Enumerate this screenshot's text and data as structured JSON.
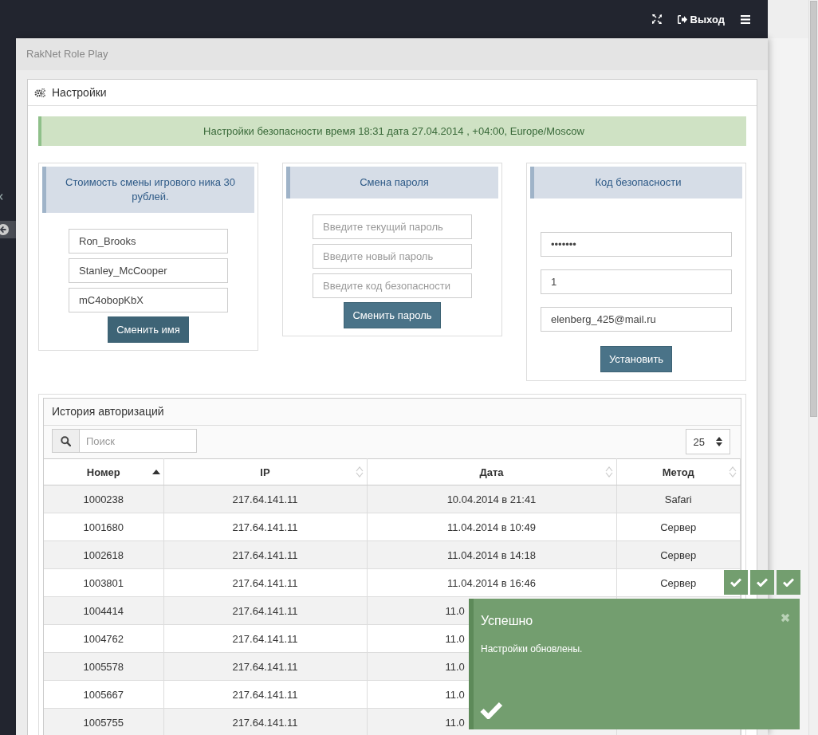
{
  "topbar": {
    "logout": "Выход"
  },
  "breadcrumb": "RakNet Role Play",
  "panel": {
    "title": "Настройки"
  },
  "alert": "Настройки безопасности время 18:31 дата 27.04.2014 , +04:00, Europe/Moscow",
  "cards": [
    {
      "title": "Стоимость смены игрового ника 30 рублей.",
      "fields": [
        {
          "value": "Ron_Brooks"
        },
        {
          "value": "Stanley_McCooper"
        },
        {
          "value": "mC4obopKbX"
        }
      ],
      "button": "Сменить имя"
    },
    {
      "title": "Смена пароля",
      "fields": [
        {
          "placeholder": "Введите текущий пароль"
        },
        {
          "placeholder": "Введите новый пароль"
        },
        {
          "placeholder": "Введите код безопасности"
        }
      ],
      "button": "Сменить пароль"
    },
    {
      "title": "Код безопасности",
      "fields": [
        {
          "value": "•••••••"
        },
        {
          "value": "1"
        },
        {
          "value": "elenberg_425@mail.ru"
        }
      ],
      "button": "Установить"
    }
  ],
  "history": {
    "title": "История авторизаций",
    "search": {
      "placeholder": "Поиск"
    },
    "page_size": "25",
    "columns": [
      {
        "label": "Номер",
        "sorted": true
      },
      {
        "label": "IP",
        "sorted": false
      },
      {
        "label": "Дата",
        "sorted": false
      },
      {
        "label": "Метод",
        "sorted": false
      }
    ],
    "rows": [
      {
        "number": "1000238",
        "ip": "217.64.141.11",
        "date": "10.04.2014 в 21:41",
        "method": "Safari"
      },
      {
        "number": "1001680",
        "ip": "217.64.141.11",
        "date": "11.04.2014 в 10:49",
        "method": "Сервер"
      },
      {
        "number": "1002618",
        "ip": "217.64.141.11",
        "date": "11.04.2014 в 14:18",
        "method": "Сервер"
      },
      {
        "number": "1003801",
        "ip": "217.64.141.11",
        "date": "11.04.2014 в 16:46",
        "method": "Сервер"
      },
      {
        "number": "1004414",
        "ip": "217.64.141.11",
        "date": "11.0"
      },
      {
        "number": "1004762",
        "ip": "217.64.141.11",
        "date": "11.0"
      },
      {
        "number": "1005578",
        "ip": "217.64.141.11",
        "date": "11.0"
      },
      {
        "number": "1005667",
        "ip": "217.64.141.11",
        "date": "11.0"
      },
      {
        "number": "1005755",
        "ip": "217.64.141.11",
        "date": "11.0"
      }
    ]
  },
  "toast": {
    "title": "Успешно",
    "message": "Настройки обновлены.",
    "stack": [
      {
        "kind": "success"
      },
      {
        "kind": "success"
      },
      {
        "kind": "success"
      }
    ]
  }
}
